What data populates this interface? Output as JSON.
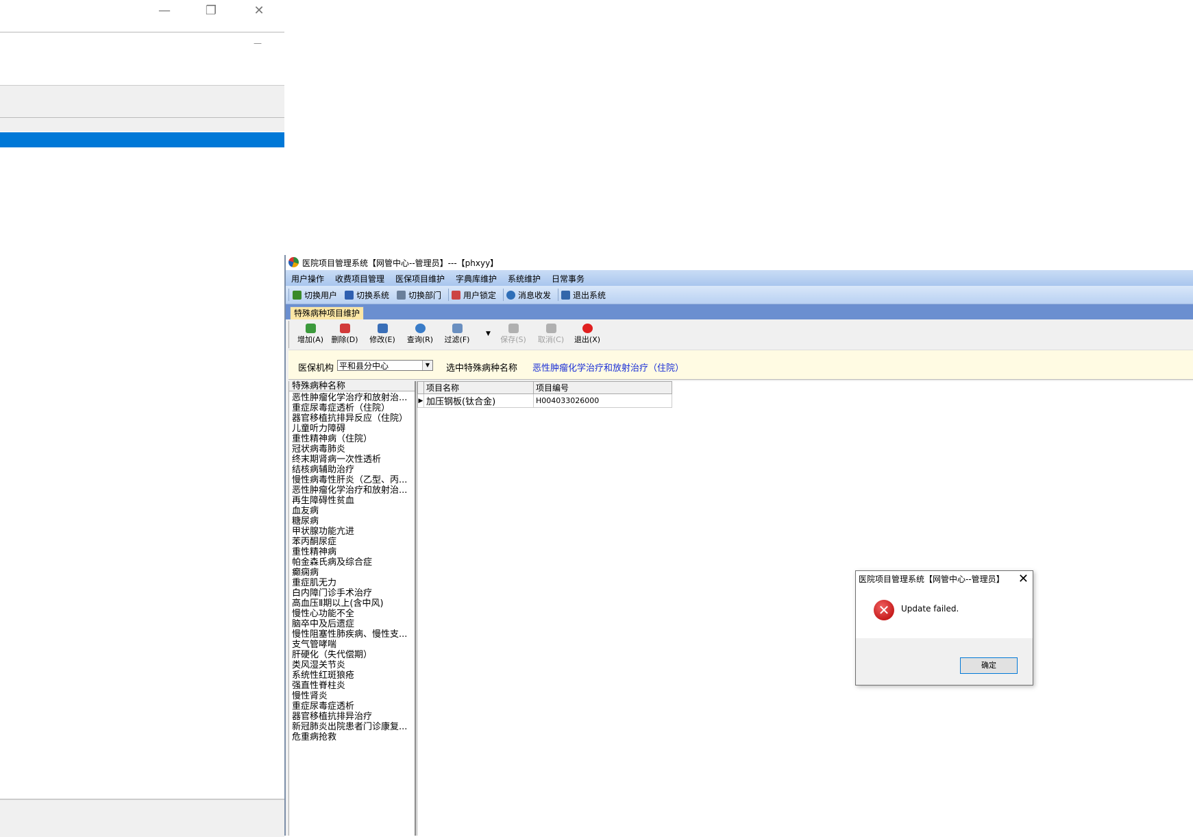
{
  "app": {
    "title": "医院项目管理系统【网管中心--管理员】---【phxyy】",
    "menu": [
      "用户操作",
      "收费项目管理",
      "医保项目维护",
      "字典库维护",
      "系统维护",
      "日常事务"
    ],
    "toolbar": [
      {
        "label": "切换用户",
        "icon": "switch-user-icon",
        "color": "#3a8a2a"
      },
      {
        "label": "切换系统",
        "icon": "switch-system-icon",
        "color": "#2f5fb0"
      },
      {
        "label": "切换部门",
        "icon": "switch-department-icon",
        "color": "#6a7f9a"
      },
      {
        "label": "用户锁定",
        "icon": "user-lock-icon",
        "color": "#c44"
      },
      {
        "label": "消息收发",
        "icon": "message-icon",
        "color": "#2f6fb8"
      },
      {
        "label": "退出系统",
        "icon": "exit-icon",
        "color": "#3366aa"
      }
    ],
    "active_tab": "特殊病种项目维护",
    "actions": [
      {
        "label": "增加(A)",
        "icon": "add-icon",
        "color": "#3c9a3c",
        "enabled": true
      },
      {
        "label": "删除(D)",
        "icon": "delete-icon",
        "color": "#d23a3a",
        "enabled": true
      },
      {
        "label": "修改(E)",
        "icon": "edit-icon",
        "color": "#3a6fb8",
        "enabled": true
      },
      {
        "label": "查询(R)",
        "icon": "query-icon",
        "color": "#3a7cc8",
        "enabled": true
      },
      {
        "label": "过滤(F)",
        "icon": "filter-icon",
        "color": "#6a8fc0",
        "enabled": true
      },
      {
        "label": "保存(S)",
        "icon": "save-icon",
        "color": "#b0b0b0",
        "enabled": false
      },
      {
        "label": "取消(C)",
        "icon": "cancel-icon",
        "color": "#b0b0b0",
        "enabled": false
      },
      {
        "label": "退出(X)",
        "icon": "power-icon",
        "color": "#e02020",
        "enabled": true
      }
    ],
    "filter": {
      "org_label": "医保机构",
      "org_value": "平和县分中心",
      "selected_label": "选中特殊病种名称",
      "selected_value": "恶性肿瘤化学治疗和放射治疗（住院）"
    },
    "left_list": {
      "header": "特殊病种名称",
      "items": [
        "恶性肿瘤化学治疗和放射治...",
        "重症尿毒症透析（住院）",
        "器官移植抗排异反应（住院）",
        "儿童听力障碍",
        "重性精神病（住院）",
        "冠状病毒肺炎",
        "终末期肾病一次性透析",
        "结核病辅助治疗",
        "慢性病毒性肝炎（乙型、丙...",
        "恶性肿瘤化学治疗和放射治...",
        "再生障碍性贫血",
        "血友病",
        "糖尿病",
        "甲状腺功能亢进",
        "苯丙酮尿症",
        "重性精神病",
        "帕金森氏病及综合症",
        "癫痫病",
        "重症肌无力",
        "白内障门诊手术治疗",
        "高血压Ⅱ期以上(含中风)",
        "慢性心功能不全",
        "脑卒中及后遗症",
        "慢性阻塞性肺疾病、慢性支...",
        "支气管哮喘",
        "肝硬化（失代偿期）",
        "类风湿关节炎",
        "系统性红斑狼疮",
        "强直性脊柱炎",
        "慢性肾炎",
        "重症尿毒症透析",
        "器官移植抗排异治疗",
        "新冠肺炎出院患者门诊康复...",
        "危重病抢救"
      ]
    },
    "grid": {
      "columns": [
        "项目名称",
        "项目编号"
      ],
      "rows": [
        [
          "加压钢板(钛合金)",
          "H004033026000"
        ]
      ]
    }
  },
  "dialog": {
    "title": "医院项目管理系统【网管中心--管理员】",
    "message": "Update failed.",
    "ok_label": "确定",
    "close_glyph": "✕",
    "icon_glyph": "✕"
  },
  "bg_window": {
    "min_glyph": "—",
    "restore_glyph": "❐",
    "close_glyph": "✕",
    "highlight_color": "#0078d7"
  }
}
